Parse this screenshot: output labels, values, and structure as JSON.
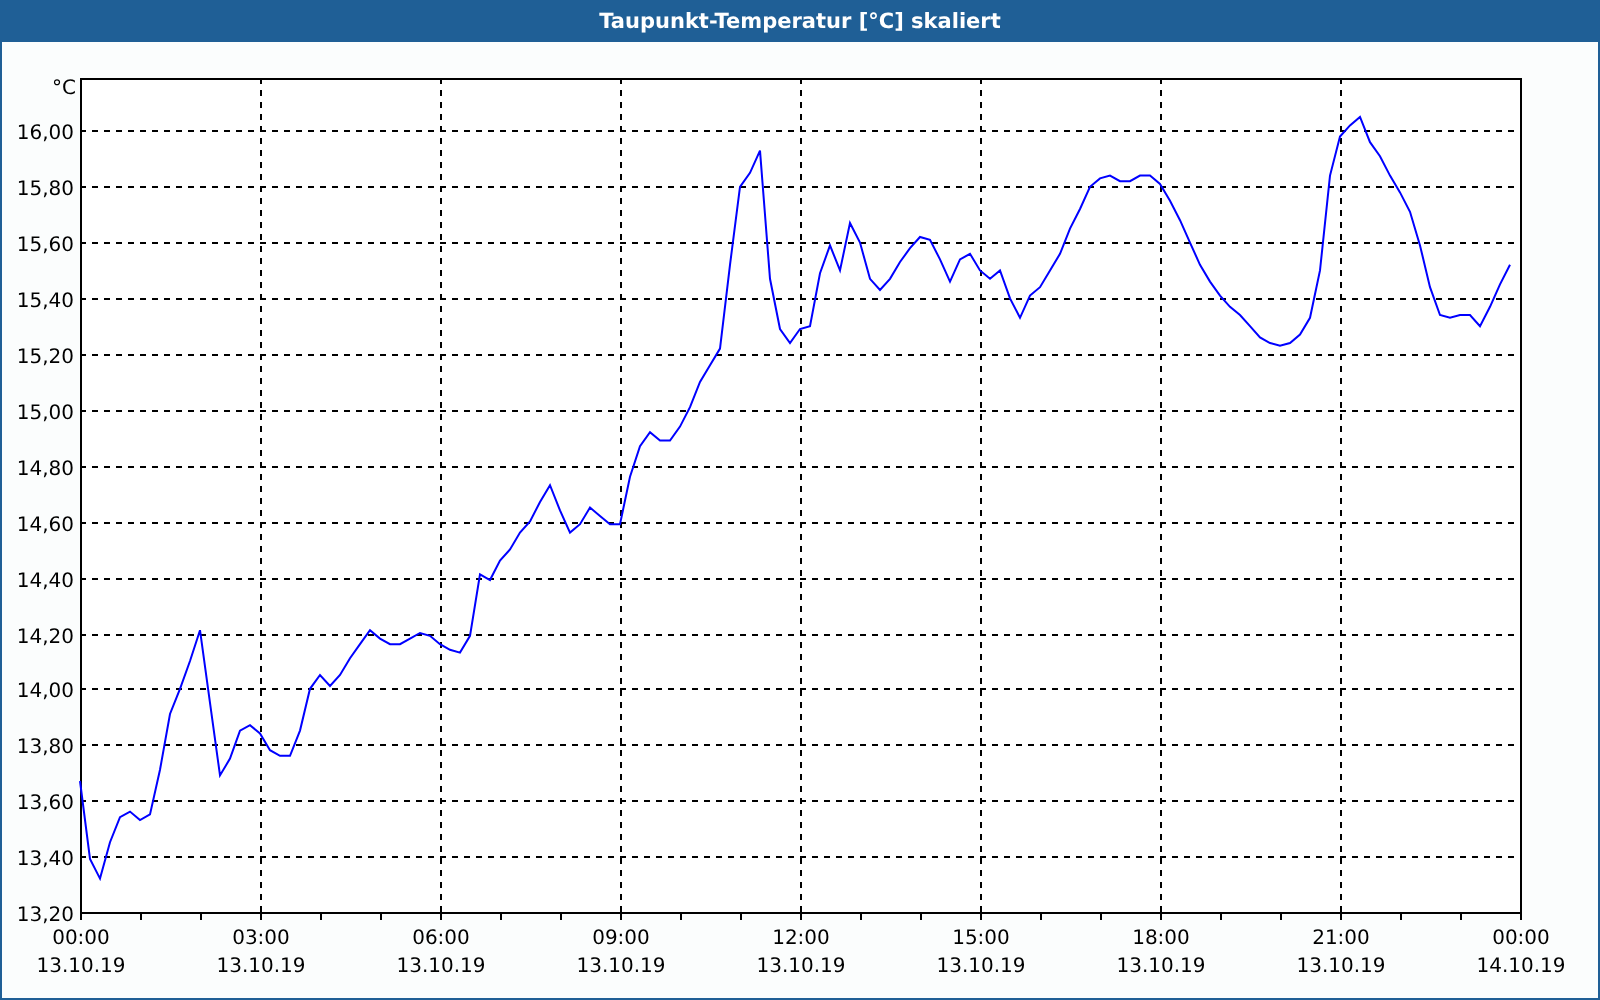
{
  "window": {
    "title": "Taupunkt-Temperatur [°C] skaliert"
  },
  "chart": {
    "chart_data": {
      "type": "line",
      "ylabel": "°C",
      "grid": true,
      "ylim": [
        13.2,
        16.19
      ],
      "categories": [
        "00:00\n13.10.19",
        null,
        null,
        null,
        null,
        null,
        null,
        null,
        null,
        null,
        null,
        null,
        null,
        null,
        null,
        null,
        null,
        null,
        "03:00\n13.10.19",
        null,
        null,
        null,
        null,
        null,
        null,
        null,
        null,
        null,
        null,
        null,
        null,
        null,
        null,
        null,
        null,
        null,
        "06:00\n13.10.19",
        null,
        null,
        null,
        null,
        null,
        null,
        null,
        null,
        null,
        null,
        null,
        null,
        null,
        null,
        null,
        null,
        null,
        "09:00\n13.10.19",
        null,
        null,
        null,
        null,
        null,
        null,
        null,
        null,
        null,
        null,
        null,
        null,
        null,
        null,
        null,
        null,
        null,
        "12:00\n13.10.19",
        null,
        null,
        null,
        null,
        null,
        null,
        null,
        null,
        null,
        null,
        null,
        null,
        null,
        null,
        null,
        null,
        null,
        "15:00\n13.10.19",
        null,
        null,
        null,
        null,
        null,
        null,
        null,
        null,
        null,
        null,
        null,
        null,
        null,
        null,
        null,
        null,
        null,
        "18:00\n13.10.19",
        null,
        null,
        null,
        null,
        null,
        null,
        null,
        null,
        null,
        null,
        null,
        null,
        null,
        null,
        null,
        null,
        null,
        "21:00\n13.10.19",
        null,
        null,
        null,
        null,
        null,
        null,
        null,
        null,
        null,
        null,
        null,
        null,
        null,
        null,
        null,
        null,
        null,
        "00:00\n14.10.19"
      ],
      "series": [
        {
          "color": "#0000ff",
          "values": [
            13.67,
            13.39,
            13.32,
            13.45,
            13.54,
            13.56,
            13.53,
            13.55,
            13.71,
            13.91,
            14,
            14.1,
            14.21,
            13.95,
            13.69,
            13.75,
            13.85,
            13.87,
            13.84,
            13.78,
            13.76,
            13.76,
            13.85,
            14,
            14.05,
            14.01,
            14.05,
            14.11,
            14.16,
            14.21,
            14.18,
            14.16,
            14.16,
            14.18,
            14.2,
            14.19,
            14.16,
            14.14,
            14.13,
            14.19,
            14.41,
            14.39,
            14.46,
            14.5,
            14.56,
            14.6,
            14.67,
            14.73,
            14.64,
            14.56,
            14.59,
            14.65,
            14.62,
            14.59,
            14.59,
            14.76,
            14.87,
            14.92,
            14.89,
            14.89,
            14.94,
            15.01,
            15.1,
            15.16,
            15.22,
            15.52,
            15.8,
            15.85,
            15.93,
            15.47,
            15.29,
            15.24,
            15.29,
            15.3,
            15.49,
            15.59,
            15.5,
            15.67,
            15.6,
            15.47,
            15.43,
            15.47,
            15.53,
            15.58,
            15.62,
            15.61,
            15.54,
            15.46,
            15.54,
            15.56,
            15.5,
            15.47,
            15.5,
            15.4,
            15.33,
            15.41,
            15.44,
            15.5,
            15.56,
            15.65,
            15.72,
            15.8,
            15.83,
            15.84,
            15.82,
            15.82,
            15.84,
            15.84,
            15.81,
            15.75,
            15.68,
            15.6,
            15.52,
            15.46,
            15.41,
            15.37,
            15.34,
            15.3,
            15.26,
            15.24,
            15.23,
            15.24,
            15.27,
            15.33,
            15.5,
            15.84,
            15.98,
            16.02,
            16.05,
            15.96,
            15.91,
            15.84,
            15.78,
            15.71,
            15.59,
            15.44,
            15.34,
            15.33,
            15.34,
            15.34,
            15.3,
            15.37,
            15.45,
            15.52,
            null
          ]
        }
      ],
      "yticks": [
        {
          "value": 13.2,
          "label": "13,20"
        },
        {
          "value": 13.4,
          "label": "13,40"
        },
        {
          "value": 13.6,
          "label": "13,60"
        },
        {
          "value": 13.8,
          "label": "13,80"
        },
        {
          "value": 14,
          "label": "14,00"
        },
        {
          "value": 14.2,
          "label": "14,20"
        },
        {
          "value": 14.4,
          "label": "14,40"
        },
        {
          "value": 14.6,
          "label": "14,60"
        },
        {
          "value": 14.8,
          "label": "14,80"
        },
        {
          "value": 15,
          "label": "15,00"
        },
        {
          "value": 15.2,
          "label": "15,20"
        },
        {
          "value": 15.4,
          "label": "15,40"
        },
        {
          "value": 15.6,
          "label": "15,60"
        },
        {
          "value": 15.8,
          "label": "15,80"
        },
        {
          "value": 16,
          "label": "16,00"
        }
      ]
    }
  }
}
